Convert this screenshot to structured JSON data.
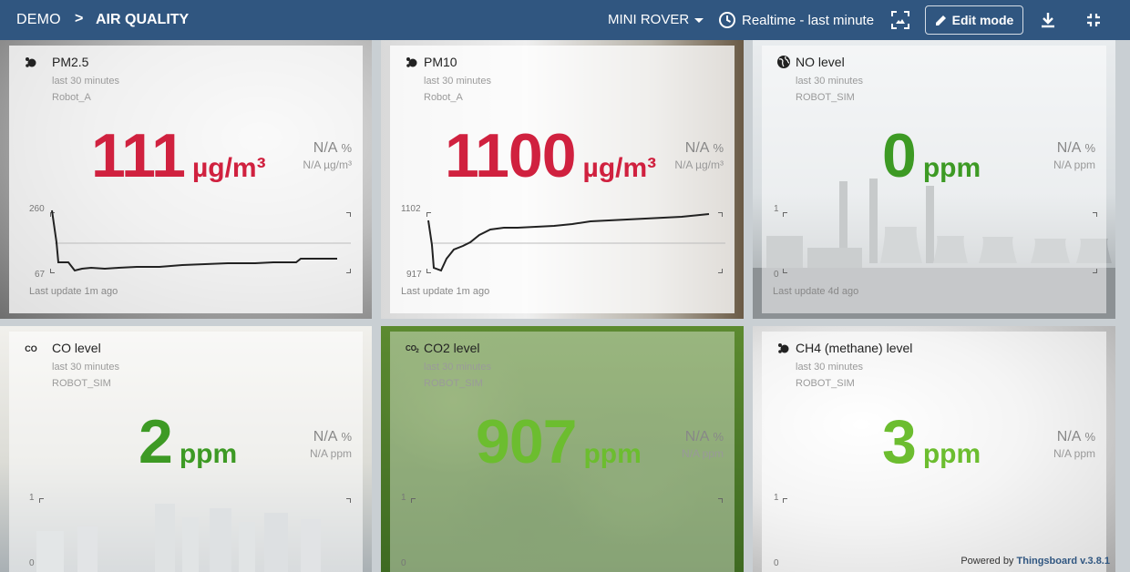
{
  "header": {
    "breadcrumb_root": "DEMO",
    "breadcrumb_separator": ">",
    "breadcrumb_current": "AIR QUALITY",
    "entity_selector": "MINI ROVER",
    "timewindow": "Realtime - last minute",
    "edit_mode_label": "Edit mode",
    "icons": [
      "dashboard-image-icon",
      "download-icon",
      "fullscreen-exit-icon",
      "clock-icon",
      "pencil-icon"
    ]
  },
  "colors": {
    "header_bg": "#305680",
    "red": "#d0213f",
    "dark_green": "#3d9a24",
    "light_green": "#6cbd2f"
  },
  "widgets": [
    {
      "title": "PM2.5",
      "icon": "molecule-icon",
      "period": "last 30 minutes",
      "source": "Robot_A",
      "value": "111",
      "unit": "µg/m³",
      "change": "N/A",
      "change_unit": "%",
      "change_abs": "N/A µg/m³",
      "axis_max": "260",
      "axis_min": "67",
      "last_update": "Last update 1m ago"
    },
    {
      "title": "PM10",
      "icon": "molecule-icon",
      "period": "last 30 minutes",
      "source": "Robot_A",
      "value": "1100",
      "unit": "µg/m³",
      "change": "N/A",
      "change_unit": "%",
      "change_abs": "N/A µg/m³",
      "axis_max": "1102",
      "axis_min": "917",
      "last_update": "Last update 1m ago"
    },
    {
      "title": "NO level",
      "icon": "globe-icon",
      "period": "last 30 minutes",
      "source": "ROBOT_SIM",
      "value": "0",
      "unit": "ppm",
      "change": "N/A",
      "change_unit": "%",
      "change_abs": "N/A ppm",
      "axis_max": "1",
      "axis_min": "0",
      "last_update": "Last update 4d ago"
    },
    {
      "title": "CO level",
      "icon": "co-icon",
      "period": "last 30 minutes",
      "source": "ROBOT_SIM",
      "value": "2",
      "unit": "ppm",
      "change": "N/A",
      "change_unit": "%",
      "change_abs": "N/A ppm",
      "axis_max": "1",
      "axis_min": "0"
    },
    {
      "title": "CO2 level",
      "icon": "co2-icon",
      "period": "last 30 minutes",
      "source": "ROBOT_SIM",
      "value": "907",
      "unit": "ppm",
      "change": "N/A",
      "change_unit": "%",
      "change_abs": "N/A ppm",
      "axis_max": "1",
      "axis_min": "0"
    },
    {
      "title": "CH4 (methane) level",
      "icon": "molecule-icon",
      "period": "last 30 minutes",
      "source": "ROBOT_SIM",
      "value": "3",
      "unit": "ppm",
      "change": "N/A",
      "change_unit": "%",
      "change_abs": "N/A ppm",
      "axis_max": "1",
      "axis_min": "0"
    }
  ],
  "footer": {
    "powered_prefix": "Powered by",
    "powered_brand": "Thingsboard v.3.8.1"
  }
}
